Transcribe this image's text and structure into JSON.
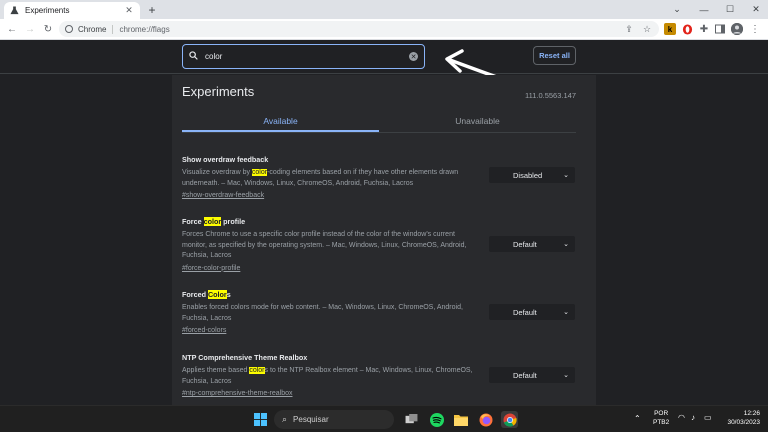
{
  "browser": {
    "tab_title": "Experiments",
    "tab_close": "✕",
    "new_tab": "+",
    "window_controls": [
      "⌄",
      "—",
      "☐",
      "✕"
    ],
    "nav": {
      "back": "←",
      "forward": "→",
      "reload": "↻"
    },
    "address_chip": "Chrome",
    "url": "chrome://flags",
    "toolbar_icons": [
      "share-icon",
      "star-icon"
    ],
    "extensions": [
      "k-extension-icon",
      "opera-extension-icon",
      "puzzle-icon",
      "sidepanel-icon",
      "avatar",
      "menu-icon"
    ]
  },
  "flags_header": {
    "search_value": "color",
    "reset_label": "Reset all"
  },
  "page": {
    "title": "Experiments",
    "version": "111.0.5563.147",
    "tabs": [
      "Available",
      "Unavailable"
    ],
    "active_tab": "Available"
  },
  "experiments": [
    {
      "name": "Show overdraw feedback",
      "desc_pre": "Visualize overdraw by ",
      "desc_mark": "color",
      "desc_post": "-coding elements based on if they have other elements drawn underneath. – Mac, Windows, Linux, ChromeOS, Android, Fuchsia, Lacros",
      "link": "#show-overdraw-feedback",
      "value": "Disabled"
    },
    {
      "name_pre": "Force ",
      "name_mark": "color",
      "name_post": " profile",
      "desc": "Forces Chrome to use a specific color profile instead of the color of the window's current monitor, as specified by the operating system. – Mac, Windows, Linux, ChromeOS, Android, Fuchsia, Lacros",
      "link": "#force-color-profile",
      "value": "Default"
    },
    {
      "name_pre": "Forced ",
      "name_mark": "Color",
      "name_post": "s",
      "desc": "Enables forced colors mode for web content. – Mac, Windows, Linux, ChromeOS, Android, Fuchsia, Lacros",
      "link": "#forced-colors",
      "value": "Default"
    },
    {
      "name": "NTP Comprehensive Theme Realbox",
      "desc_pre": "Applies theme based ",
      "desc_mark": "color",
      "desc_post": "s to the NTP Realbox element – Mac, Windows, Linux, ChromeOS, Fuchsia, Lacros",
      "link": "#ntp-comprehensive-theme-realbox",
      "value": "Default"
    }
  ],
  "taskbar": {
    "search_placeholder": "Pesquisar",
    "apps": [
      "windows-start-icon",
      "search-icon",
      "task-view-icon",
      "spotify-icon",
      "file-explorer-icon",
      "firefox-icon",
      "chrome-icon"
    ],
    "language": "POR",
    "layout": "PTB2",
    "time": "12:26",
    "date": "30/03/2023"
  },
  "colors": {
    "accent": "#8ab4f8",
    "highlight": "#fdfd00",
    "page_bg": "#202124",
    "panel_bg": "#292a2d"
  }
}
